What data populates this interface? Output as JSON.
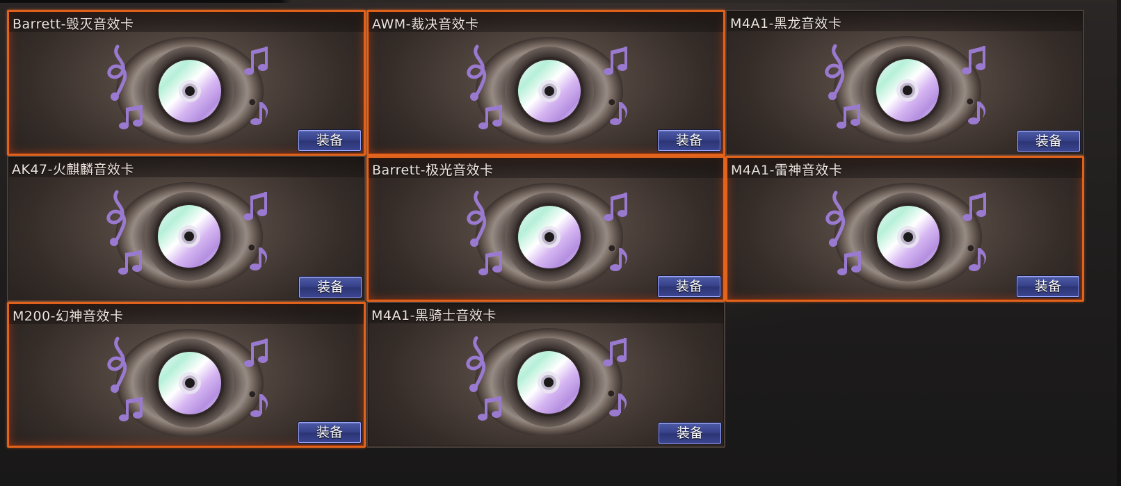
{
  "panel": {
    "cards": [
      {
        "title": "Barrett-毁灭音效卡",
        "button": "装备",
        "selected": true
      },
      {
        "title": "AWM-裁决音效卡",
        "button": "装备",
        "selected": true
      },
      {
        "title": "M4A1-黑龙音效卡",
        "button": "装备",
        "selected": false
      },
      {
        "title": "AK47-火麒麟音效卡",
        "button": "装备",
        "selected": false
      },
      {
        "title": "Barrett-极光音效卡",
        "button": "装备",
        "selected": true
      },
      {
        "title": "M4A1-雷神音效卡",
        "button": "装备",
        "selected": true
      },
      {
        "title": "M200-幻神音效卡",
        "button": "装备",
        "selected": true
      },
      {
        "title": "M4A1-黑骑士音效卡",
        "button": "装备",
        "selected": false
      }
    ]
  },
  "colors": {
    "selected_border": "#e1631b",
    "button_bg": "#37428a",
    "note_purple": "#9a7ad0"
  },
  "icons": {
    "card_art": "speaker-disc-icon",
    "notes": "music-note-icon"
  }
}
